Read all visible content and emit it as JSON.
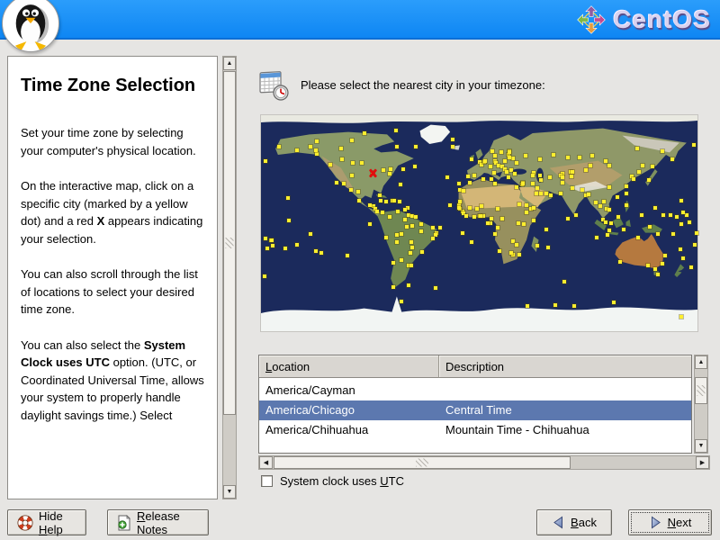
{
  "header": {
    "brand_text": "CentOS",
    "bar_color": "#1790f6"
  },
  "help": {
    "title": "Time Zone Selection",
    "p1": "Set your time zone by selecting your computer's physical location.",
    "p2_pre": "On the interactive map, click on a specific city (marked by a yellow dot) and a red ",
    "p2_bold": "X",
    "p2_post": " appears indicating your selection.",
    "p3": "You can also scroll through the list of locations to select your desired time zone.",
    "p4_pre": "You can also select the ",
    "p4_bold": "System Clock uses UTC",
    "p4_post": " option. (UTC, or Coordinated Universal Time, allows your system to properly handle daylight savings time.) Select"
  },
  "prompt": {
    "text": "Please select the nearest city in your timezone:",
    "icon": "calendar-clock"
  },
  "map": {
    "ocean_color": "#1b2a5c",
    "dot_color": "#ffee2e",
    "marker_color": "#e00d0d",
    "marker": {
      "lon": -87.6,
      "lat": 41.8
    },
    "cities": [
      [
        -150,
        61
      ],
      [
        -123,
        49
      ],
      [
        -118,
        34
      ],
      [
        -112,
        33
      ],
      [
        -105,
        40
      ],
      [
        -113,
        53
      ],
      [
        -97,
        50
      ],
      [
        -88,
        42
      ],
      [
        -99,
        19
      ],
      [
        -106,
        28
      ],
      [
        -100,
        26
      ],
      [
        -74,
        41
      ],
      [
        -79,
        44
      ],
      [
        -73,
        45
      ],
      [
        -63,
        45
      ],
      [
        -53,
        47
      ],
      [
        -82,
        23
      ],
      [
        -81,
        19
      ],
      [
        -77,
        18
      ],
      [
        -80,
        9
      ],
      [
        -74,
        5
      ],
      [
        -77,
        -12
      ],
      [
        -67,
        10
      ],
      [
        -68,
        -16
      ],
      [
        -71,
        -33
      ],
      [
        -58,
        -35
      ],
      [
        -56,
        -35
      ],
      [
        -47,
        -24
      ],
      [
        -68,
        -10
      ],
      [
        -60,
        -3
      ],
      [
        -48,
        -1
      ],
      [
        -38,
        -4
      ],
      [
        -35,
        -8
      ],
      [
        -52,
        64
      ],
      [
        -65,
        32
      ],
      [
        -26,
        38
      ],
      [
        -36,
        -54
      ],
      [
        -58,
        -52
      ],
      [
        -71,
        -53
      ],
      [
        -90,
        -1
      ],
      [
        -109,
        -27
      ],
      [
        -158,
        21
      ],
      [
        -150,
        -18
      ],
      [
        -139,
        -9
      ],
      [
        -134,
        58
      ],
      [
        -135,
        61
      ],
      [
        -114,
        62
      ],
      [
        -68,
        64
      ],
      [
        -69,
        77
      ],
      [
        -95,
        75
      ],
      [
        -105,
        69
      ],
      [
        -134,
        68
      ],
      [
        -165,
        64
      ],
      [
        -176,
        52
      ],
      [
        -139,
        64
      ],
      [
        -104,
        50
      ],
      [
        -87,
        14
      ],
      [
        -90,
        15
      ],
      [
        -86,
        12
      ],
      [
        -84,
        10
      ],
      [
        -72,
        19
      ],
      [
        -70,
        19
      ],
      [
        -66,
        18
      ],
      [
        -59,
        13
      ],
      [
        -61,
        11
      ],
      [
        -58,
        7
      ],
      [
        -55,
        6
      ],
      [
        -52,
        5
      ],
      [
        -57,
        -25
      ],
      [
        -64,
        -31
      ],
      [
        -56,
        -16
      ],
      [
        -55,
        -20
      ],
      [
        -61,
        3
      ],
      [
        -64,
        -9
      ],
      [
        -55,
        -2
      ],
      [
        -36,
        -10
      ],
      [
        -38,
        -13
      ],
      [
        -48,
        -7
      ],
      [
        -32,
        -4
      ],
      [
        -22,
        70
      ],
      [
        -22,
        64
      ],
      [
        -9,
        39
      ],
      [
        -4,
        40
      ],
      [
        -6,
        53
      ],
      [
        0,
        51
      ],
      [
        2,
        49
      ],
      [
        4,
        51
      ],
      [
        5,
        52
      ],
      [
        11,
        60
      ],
      [
        13,
        56
      ],
      [
        13,
        52
      ],
      [
        14,
        50
      ],
      [
        16,
        48
      ],
      [
        12,
        42
      ],
      [
        9,
        47
      ],
      [
        18,
        59
      ],
      [
        21,
        52
      ],
      [
        19,
        47
      ],
      [
        21,
        45
      ],
      [
        24,
        38
      ],
      [
        26,
        44
      ],
      [
        23,
        43
      ],
      [
        25,
        60
      ],
      [
        31,
        50
      ],
      [
        28,
        54
      ],
      [
        24,
        57
      ],
      [
        25,
        55
      ],
      [
        25,
        59
      ],
      [
        38,
        56
      ],
      [
        29,
        41
      ],
      [
        -17,
        33
      ],
      [
        -16,
        28
      ],
      [
        -8,
        34
      ],
      [
        3,
        37
      ],
      [
        10,
        37
      ],
      [
        13,
        33
      ],
      [
        31,
        30
      ],
      [
        3,
        6
      ],
      [
        0,
        6
      ],
      [
        -4,
        5
      ],
      [
        -17,
        15
      ],
      [
        -8,
        13
      ],
      [
        2,
        14
      ],
      [
        15,
        12
      ],
      [
        33,
        16
      ],
      [
        39,
        9
      ],
      [
        37,
        -1
      ],
      [
        45,
        2
      ],
      [
        32,
        0
      ],
      [
        15,
        -4
      ],
      [
        13,
        -9
      ],
      [
        28,
        -15
      ],
      [
        31,
        -18
      ],
      [
        28,
        -26
      ],
      [
        17,
        -23
      ],
      [
        26,
        -25
      ],
      [
        33,
        -26
      ],
      [
        48,
        -19
      ],
      [
        57,
        -20
      ],
      [
        55,
        -5
      ],
      [
        43,
        12
      ],
      [
        39,
        15
      ],
      [
        19,
        4
      ],
      [
        9,
        0
      ],
      [
        10,
        4
      ],
      [
        7,
        0
      ],
      [
        -14,
        10
      ],
      [
        -13,
        8
      ],
      [
        -11,
        6
      ],
      [
        -16,
        12
      ],
      [
        -17,
        13
      ],
      [
        -16,
        18
      ],
      [
        -13,
        27
      ],
      [
        -2,
        12
      ],
      [
        1,
        6
      ],
      [
        -24,
        15
      ],
      [
        -6,
        -16
      ],
      [
        -14,
        -8
      ],
      [
        35,
        32
      ],
      [
        36,
        34
      ],
      [
        36,
        33
      ],
      [
        44,
        33
      ],
      [
        47,
        25
      ],
      [
        48,
        29
      ],
      [
        51,
        25
      ],
      [
        55,
        25
      ],
      [
        59,
        23
      ],
      [
        45,
        13
      ],
      [
        51,
        36
      ],
      [
        50,
        40
      ],
      [
        45,
        42
      ],
      [
        44,
        40
      ],
      [
        69,
        34
      ],
      [
        67,
        25
      ],
      [
        69,
        41
      ],
      [
        67,
        40
      ],
      [
        69,
        38
      ],
      [
        58,
        38
      ],
      [
        75,
        43
      ],
      [
        77,
        43
      ],
      [
        77,
        29
      ],
      [
        88,
        23
      ],
      [
        80,
        7
      ],
      [
        85,
        28
      ],
      [
        90,
        24
      ],
      [
        96,
        17
      ],
      [
        100,
        14
      ],
      [
        105,
        12
      ],
      [
        107,
        11
      ],
      [
        103,
        18
      ],
      [
        107,
        -6
      ],
      [
        109,
        0
      ],
      [
        119,
        -5
      ],
      [
        141,
        -3
      ],
      [
        102,
        3
      ],
      [
        104,
        1
      ],
      [
        121,
        15
      ],
      [
        115,
        5
      ],
      [
        114,
        22
      ],
      [
        121,
        25
      ],
      [
        121,
        31
      ],
      [
        107,
        30
      ],
      [
        88,
        44
      ],
      [
        76,
        39
      ],
      [
        107,
        48
      ],
      [
        92,
        48
      ],
      [
        126,
        39
      ],
      [
        127,
        37
      ],
      [
        140,
        36
      ],
      [
        132,
        43
      ],
      [
        135,
        48
      ],
      [
        130,
        62
      ],
      [
        104,
        52
      ],
      [
        93,
        56
      ],
      [
        83,
        55
      ],
      [
        73,
        55
      ],
      [
        61,
        57
      ],
      [
        50,
        53
      ],
      [
        151,
        60
      ],
      [
        159,
        53
      ],
      [
        177,
        65
      ],
      [
        143,
        47
      ],
      [
        73,
        4
      ],
      [
        116,
        -32
      ],
      [
        131,
        -12
      ],
      [
        139,
        -35
      ],
      [
        153,
        -27
      ],
      [
        151,
        -34
      ],
      [
        145,
        -38
      ],
      [
        147,
        -43
      ],
      [
        147,
        -9
      ],
      [
        160,
        -9
      ],
      [
        166,
        -22
      ],
      [
        175,
        -37
      ],
      [
        -177,
        -44
      ],
      [
        178,
        -18
      ],
      [
        173,
        1
      ],
      [
        171,
        7
      ],
      [
        145,
        13
      ],
      [
        134,
        7
      ],
      [
        152,
        7
      ],
      [
        158,
        7
      ],
      [
        163,
        5
      ],
      [
        167,
        19
      ],
      [
        168,
        -29
      ],
      [
        167,
        -1
      ],
      [
        179,
        -8
      ],
      [
        -176,
        -13
      ],
      [
        -172,
        -14
      ],
      [
        -171,
        -14
      ],
      [
        -175,
        -21
      ],
      [
        -170,
        -19
      ],
      [
        -160,
        -21
      ],
      [
        -157,
        2
      ],
      [
        -135,
        -23
      ],
      [
        -130,
        -25
      ],
      [
        168,
        9
      ],
      [
        63,
        -68
      ],
      [
        78,
        -69
      ],
      [
        111,
        -66
      ],
      [
        167,
        -78
      ],
      [
        -64,
        -65
      ],
      [
        40,
        -69
      ],
      [
        70,
        -49
      ],
      [
        97,
        -12
      ],
      [
        106,
        -10
      ]
    ]
  },
  "tz_table": {
    "col_location": {
      "mn": "L",
      "post": "ocation"
    },
    "col_description": {
      "label": "Description"
    },
    "selected_bg": "#5c78af",
    "rows": [
      {
        "location": "America/Cayman",
        "description": "",
        "selected": false
      },
      {
        "location": "America/Chicago",
        "description": "Central Time",
        "selected": true
      },
      {
        "location": "America/Chihuahua",
        "description": "Mountain Time - Chihuahua",
        "selected": false
      }
    ]
  },
  "utc_checkbox": {
    "checked": false,
    "pre": "System clock uses ",
    "mn": "U",
    "post": "TC"
  },
  "buttons": {
    "hide_help": {
      "pre": "Hide ",
      "mn": "H",
      "post": "elp"
    },
    "release_notes": {
      "pre": "",
      "mn": "R",
      "post": "elease Notes"
    },
    "back": {
      "pre": "",
      "mn": "B",
      "post": "ack"
    },
    "next": {
      "pre": "",
      "mn": "N",
      "post": "ext"
    }
  }
}
